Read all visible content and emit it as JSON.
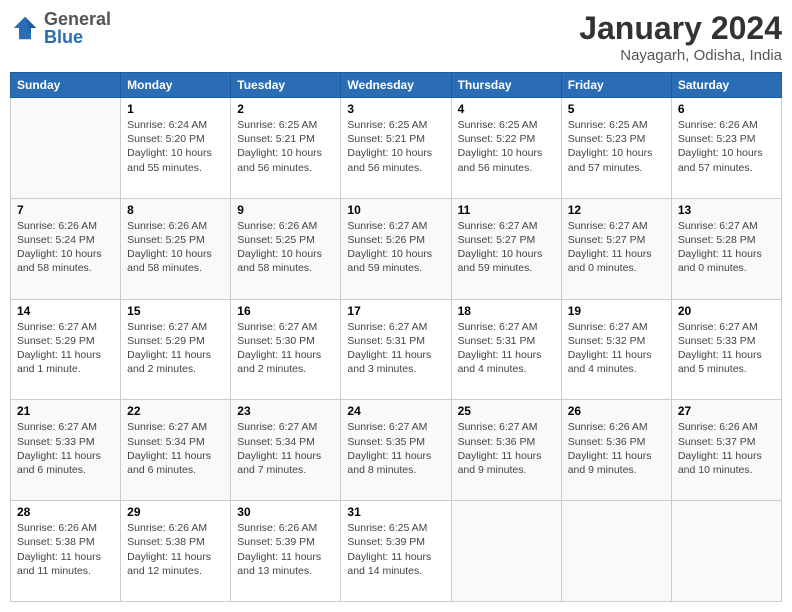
{
  "header": {
    "logo_line1": "General",
    "logo_line2": "Blue",
    "month": "January 2024",
    "location": "Nayagarh, Odisha, India"
  },
  "days_of_week": [
    "Sunday",
    "Monday",
    "Tuesday",
    "Wednesday",
    "Thursday",
    "Friday",
    "Saturday"
  ],
  "weeks": [
    [
      {
        "day": "",
        "info": ""
      },
      {
        "day": "1",
        "info": "Sunrise: 6:24 AM\nSunset: 5:20 PM\nDaylight: 10 hours\nand 55 minutes."
      },
      {
        "day": "2",
        "info": "Sunrise: 6:25 AM\nSunset: 5:21 PM\nDaylight: 10 hours\nand 56 minutes."
      },
      {
        "day": "3",
        "info": "Sunrise: 6:25 AM\nSunset: 5:21 PM\nDaylight: 10 hours\nand 56 minutes."
      },
      {
        "day": "4",
        "info": "Sunrise: 6:25 AM\nSunset: 5:22 PM\nDaylight: 10 hours\nand 56 minutes."
      },
      {
        "day": "5",
        "info": "Sunrise: 6:25 AM\nSunset: 5:23 PM\nDaylight: 10 hours\nand 57 minutes."
      },
      {
        "day": "6",
        "info": "Sunrise: 6:26 AM\nSunset: 5:23 PM\nDaylight: 10 hours\nand 57 minutes."
      }
    ],
    [
      {
        "day": "7",
        "info": "Sunrise: 6:26 AM\nSunset: 5:24 PM\nDaylight: 10 hours\nand 58 minutes."
      },
      {
        "day": "8",
        "info": "Sunrise: 6:26 AM\nSunset: 5:25 PM\nDaylight: 10 hours\nand 58 minutes."
      },
      {
        "day": "9",
        "info": "Sunrise: 6:26 AM\nSunset: 5:25 PM\nDaylight: 10 hours\nand 58 minutes."
      },
      {
        "day": "10",
        "info": "Sunrise: 6:27 AM\nSunset: 5:26 PM\nDaylight: 10 hours\nand 59 minutes."
      },
      {
        "day": "11",
        "info": "Sunrise: 6:27 AM\nSunset: 5:27 PM\nDaylight: 10 hours\nand 59 minutes."
      },
      {
        "day": "12",
        "info": "Sunrise: 6:27 AM\nSunset: 5:27 PM\nDaylight: 11 hours\nand 0 minutes."
      },
      {
        "day": "13",
        "info": "Sunrise: 6:27 AM\nSunset: 5:28 PM\nDaylight: 11 hours\nand 0 minutes."
      }
    ],
    [
      {
        "day": "14",
        "info": "Sunrise: 6:27 AM\nSunset: 5:29 PM\nDaylight: 11 hours\nand 1 minute."
      },
      {
        "day": "15",
        "info": "Sunrise: 6:27 AM\nSunset: 5:29 PM\nDaylight: 11 hours\nand 2 minutes."
      },
      {
        "day": "16",
        "info": "Sunrise: 6:27 AM\nSunset: 5:30 PM\nDaylight: 11 hours\nand 2 minutes."
      },
      {
        "day": "17",
        "info": "Sunrise: 6:27 AM\nSunset: 5:31 PM\nDaylight: 11 hours\nand 3 minutes."
      },
      {
        "day": "18",
        "info": "Sunrise: 6:27 AM\nSunset: 5:31 PM\nDaylight: 11 hours\nand 4 minutes."
      },
      {
        "day": "19",
        "info": "Sunrise: 6:27 AM\nSunset: 5:32 PM\nDaylight: 11 hours\nand 4 minutes."
      },
      {
        "day": "20",
        "info": "Sunrise: 6:27 AM\nSunset: 5:33 PM\nDaylight: 11 hours\nand 5 minutes."
      }
    ],
    [
      {
        "day": "21",
        "info": "Sunrise: 6:27 AM\nSunset: 5:33 PM\nDaylight: 11 hours\nand 6 minutes."
      },
      {
        "day": "22",
        "info": "Sunrise: 6:27 AM\nSunset: 5:34 PM\nDaylight: 11 hours\nand 6 minutes."
      },
      {
        "day": "23",
        "info": "Sunrise: 6:27 AM\nSunset: 5:34 PM\nDaylight: 11 hours\nand 7 minutes."
      },
      {
        "day": "24",
        "info": "Sunrise: 6:27 AM\nSunset: 5:35 PM\nDaylight: 11 hours\nand 8 minutes."
      },
      {
        "day": "25",
        "info": "Sunrise: 6:27 AM\nSunset: 5:36 PM\nDaylight: 11 hours\nand 9 minutes."
      },
      {
        "day": "26",
        "info": "Sunrise: 6:26 AM\nSunset: 5:36 PM\nDaylight: 11 hours\nand 9 minutes."
      },
      {
        "day": "27",
        "info": "Sunrise: 6:26 AM\nSunset: 5:37 PM\nDaylight: 11 hours\nand 10 minutes."
      }
    ],
    [
      {
        "day": "28",
        "info": "Sunrise: 6:26 AM\nSunset: 5:38 PM\nDaylight: 11 hours\nand 11 minutes."
      },
      {
        "day": "29",
        "info": "Sunrise: 6:26 AM\nSunset: 5:38 PM\nDaylight: 11 hours\nand 12 minutes."
      },
      {
        "day": "30",
        "info": "Sunrise: 6:26 AM\nSunset: 5:39 PM\nDaylight: 11 hours\nand 13 minutes."
      },
      {
        "day": "31",
        "info": "Sunrise: 6:25 AM\nSunset: 5:39 PM\nDaylight: 11 hours\nand 14 minutes."
      },
      {
        "day": "",
        "info": ""
      },
      {
        "day": "",
        "info": ""
      },
      {
        "day": "",
        "info": ""
      }
    ]
  ]
}
